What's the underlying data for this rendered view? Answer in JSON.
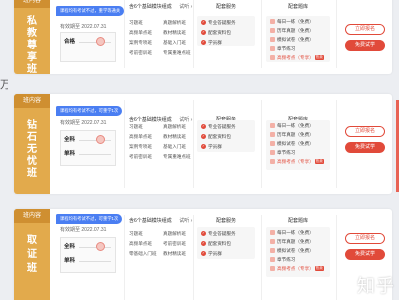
{
  "edge_char": "万",
  "watermark": "知乎",
  "plans": [
    {
      "badge": "班内容",
      "name_chars": [
        "私",
        "教",
        "尊",
        "享",
        "班"
      ],
      "tag": "课程均有考试不过，重学等通关",
      "date_label": "有效期至 2022.07.31",
      "slip_rows": [
        "合格"
      ],
      "modules_head": "含6个基础模块组成",
      "modules_link": "试听 ›",
      "modules": [
        "习题班",
        "高频单点班",
        "案例专项班",
        "考前密训班",
        "真题解析班",
        "教材精读班",
        "基础入门班",
        "专属重难点班"
      ],
      "services_head": "配套服务",
      "services": [
        "专业答疑服务",
        "配套资料包",
        "学员群"
      ],
      "bank_head": "配套题库",
      "bank": [
        "每日一练（免费）",
        "历年真题（免费）",
        "模拟试卷（免费）",
        "章节练习",
        "高频考点（专享）"
      ],
      "hot_label": "热卖",
      "btn_primary": "立即报名",
      "btn_free": "免费试学"
    },
    {
      "badge": "班内容",
      "name_chars": [
        "钻",
        "石",
        "无",
        "忧",
        "班"
      ],
      "tag": "课程均有考试不过，可重学1次",
      "date_label": "有效期至 2022.07.31",
      "slip_rows": [
        "全科",
        "单科"
      ],
      "modules_head": "含6个基础模块组成",
      "modules_link": "试听 ›",
      "modules": [
        "习题班",
        "高频单点班",
        "案例专项班",
        "考前密训班",
        "真题解析班",
        "教材精读班",
        "基础入门班",
        "专属重难点班"
      ],
      "services_head": "配套服务",
      "services": [
        "专业答疑服务",
        "配套资料包",
        "学员群"
      ],
      "bank_head": "配套题库",
      "bank": [
        "每日一练（免费）",
        "历年真题（免费）",
        "模拟试卷（免费）",
        "章节练习",
        "高频考点（专享）"
      ],
      "hot_label": "热卖",
      "btn_primary": "立即报名",
      "btn_free": "免费试学"
    },
    {
      "badge": "班内容",
      "name_chars": [
        "取",
        "证",
        "班"
      ],
      "tag": "课程均有考试不过，可重学1次",
      "date_label": "有效期至 2022.07.31",
      "slip_rows": [
        "全科",
        "单科"
      ],
      "modules_head": "含6个基础模块组成",
      "modules_link": "试听 ›",
      "modules": [
        "习题班",
        "高频单点班",
        "零基础入门班",
        "真题解析班",
        "考前密训班",
        "教材精读班"
      ],
      "services_head": "配套服务",
      "services": [
        "专业答疑服务",
        "配套资料包",
        "学员群"
      ],
      "bank_head": "配套题库",
      "bank": [
        "每日一练（免费）",
        "历年真题（免费）",
        "模拟试卷（免费）",
        "章节练习",
        "高频考点（专享）"
      ],
      "hot_label": "热卖",
      "btn_primary": "立即报名",
      "btn_free": "免费试学"
    }
  ]
}
